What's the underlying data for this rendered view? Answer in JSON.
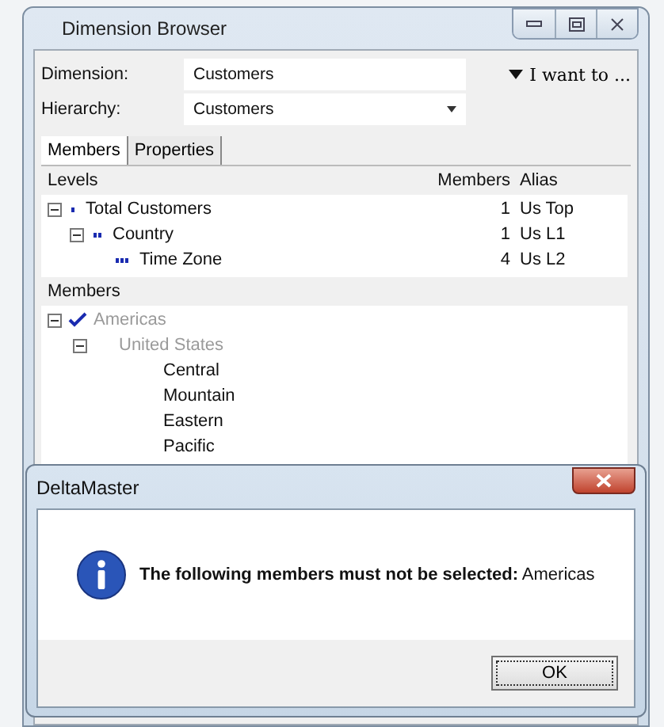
{
  "window": {
    "title": "Dimension Browser"
  },
  "dimension": {
    "label": "Dimension:",
    "value": "Customers"
  },
  "menu_button": {
    "label": "I want to ..."
  },
  "hierarchy": {
    "label": "Hierarchy:",
    "value": "Customers"
  },
  "tabs": [
    {
      "label": "Members",
      "selected": true
    },
    {
      "label": "Properties",
      "selected": false
    }
  ],
  "levels": {
    "columns": [
      "Levels",
      "Members",
      "Alias"
    ],
    "rows": [
      {
        "name": "Total Customers",
        "members": "1",
        "alias": "Us Top",
        "expanded": true,
        "children": [
          {
            "name": "Country",
            "members": "1",
            "alias": "Us L1",
            "expanded": true,
            "children": [
              {
                "name": "Time Zone",
                "members": "4",
                "alias": "Us L2"
              }
            ]
          }
        ]
      }
    ]
  },
  "members": {
    "title": "Members",
    "items": [
      {
        "label": "Americas",
        "checked": true,
        "disabled": true,
        "expanded": true,
        "children": [
          {
            "label": "United States",
            "checked": false,
            "disabled": true,
            "expanded": true,
            "children": [
              {
                "label": "Central",
                "checked": false,
                "disabled": false
              },
              {
                "label": "Mountain",
                "checked": false,
                "disabled": false
              },
              {
                "label": "Eastern",
                "checked": false,
                "disabled": false
              },
              {
                "label": "Pacific",
                "checked": false,
                "disabled": false
              }
            ]
          }
        ]
      }
    ]
  },
  "dialog": {
    "title": "DeltaMaster",
    "message": "**The following members must not be selected:** Americas",
    "buttons": [
      "OK"
    ]
  }
}
